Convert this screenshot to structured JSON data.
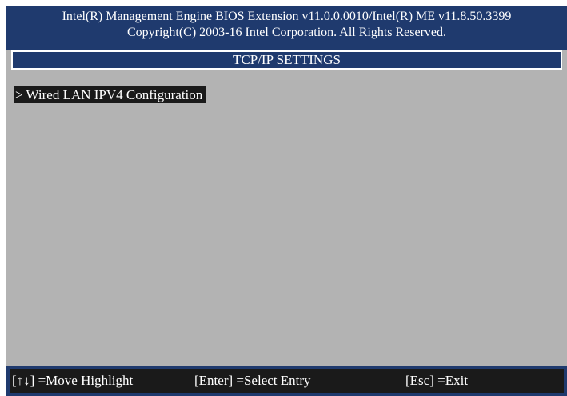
{
  "header": {
    "line1": "Intel(R) Management Engine BIOS Extension v11.0.0.0010/Intel(R) ME v11.8.50.3399",
    "line2": "Copyright(C) 2003-16 Intel Corporation. All Rights Reserved."
  },
  "title": "TCP/IP SETTINGS",
  "menu": {
    "items": [
      {
        "label": "> Wired LAN IPV4 Configuration",
        "selected": true
      }
    ]
  },
  "footer": {
    "move": "[↑↓] =Move Highlight",
    "select": "[Enter] =Select Entry",
    "exit": "[Esc] =Exit"
  },
  "colors": {
    "header_bg": "#1f3a6e",
    "body_bg": "#b3b3b3",
    "highlight_bg": "#1a1a1a",
    "text": "#ffffff"
  }
}
